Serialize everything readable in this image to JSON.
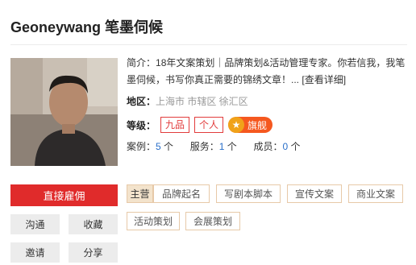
{
  "profile": {
    "name": "Geoneywang 笔墨伺候"
  },
  "intro": {
    "label": "简介：",
    "text": "18年文案策划｜品牌策划&活动管理专家。你若信我，我笔墨伺候，书写你真正需要的锦绣文章！...",
    "more": "[查看详细]"
  },
  "region": {
    "label": "地区：",
    "value": "上海市 市辖区 徐汇区"
  },
  "grade": {
    "label": "等级：",
    "tags": [
      "九品",
      "个人"
    ],
    "flagship": "旗舰",
    "flag_color": "#f5581f"
  },
  "stats": {
    "cases_label": "案例：",
    "cases": "5",
    "services_label": "服务：",
    "services": "1",
    "members_label": "成员：",
    "members": "0",
    "unit": "个"
  },
  "actions": {
    "hire": "直接雇佣",
    "communicate": "沟通",
    "favorite": "收藏",
    "invite": "邀请",
    "share": "分享",
    "accent": "#e02b2b"
  },
  "skills": {
    "main_label": "主营",
    "items": [
      "品牌起名",
      "写剧本脚本",
      "宣传文案",
      "商业文案",
      "活动策划",
      "会展策划"
    ]
  }
}
